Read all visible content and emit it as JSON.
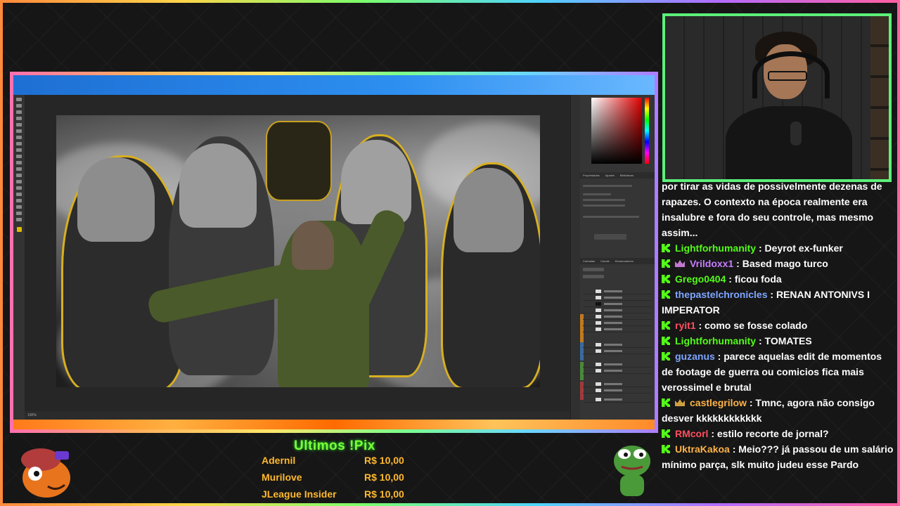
{
  "colors": {
    "accent_green": "#53fc18",
    "pix_orange": "#ffb92e",
    "pix_title_green": "#7cff3a",
    "webcam_border": "#5cf07a"
  },
  "photoshop": {
    "panel_tabs_props": [
      "Propriedades",
      "Ajustes",
      "Bibliotecas"
    ],
    "panel_tabs_layers": [
      "Camadas",
      "Canais",
      "Demarcadores"
    ],
    "status_zoom": "100%"
  },
  "chat": {
    "continuation": "por tirar as vidas de possivelmente dezenas de rapazes. O contexto na época realmente era insalubre e fora do seu controle, mas mesmo assim...",
    "messages": [
      {
        "badge": "kick-icon",
        "user": "Lightforhumanity",
        "color": "#53fc18",
        "text": ": Deyrot ex-funker"
      },
      {
        "badge": "kick-icon",
        "badge2": "crown-icon",
        "user": "Vrildoxx1",
        "color": "#c77dff",
        "text": ": Based mago turco"
      },
      {
        "badge": "kick-icon",
        "user": "Grego0404",
        "color": "#53fc18",
        "text": ": ficou foda"
      },
      {
        "badge": "kick-icon",
        "user": "thepastelchronicles",
        "color": "#7fa6ff",
        "text": ": RENAN ANTONIVS I IMPERATOR"
      },
      {
        "badge": "kick-icon",
        "user": "ryit1",
        "color": "#ff4f5e",
        "text": ": como se fosse colado"
      },
      {
        "badge": "kick-icon",
        "user": "Lightforhumanity",
        "color": "#53fc18",
        "text": ": TOMATES"
      },
      {
        "badge": "kick-icon",
        "user": "guzanus",
        "color": "#7fa6ff",
        "text": ": parece aquelas edit de momentos de footage de guerra ou comicios fica mais verossimel e brutal"
      },
      {
        "badge": "kick-icon",
        "badge2": "crown-icon",
        "user": "castlegrilow",
        "color": "#ffb347",
        "text": ": Tmnc, agora não consigo desver kkkkkkkkkkkk"
      },
      {
        "badge": "kick-icon",
        "user": "RMcorl",
        "color": "#ff4f5e",
        "text": ": estilo recorte de jornal?"
      },
      {
        "badge": "kick-icon",
        "user": "UktraKakoa",
        "color": "#ffb347",
        "text": ": Meio??? já passou de um salário mínimo parça, slk muito judeu esse Pardo"
      }
    ]
  },
  "pix": {
    "title": "Ultimos !Pix",
    "donations": [
      {
        "name": "Adernil",
        "amount": "R$ 10,00"
      },
      {
        "name": "Murilove",
        "amount": "R$ 10,00"
      },
      {
        "name": "JLeague Insider",
        "amount": "R$ 10,00"
      }
    ]
  }
}
